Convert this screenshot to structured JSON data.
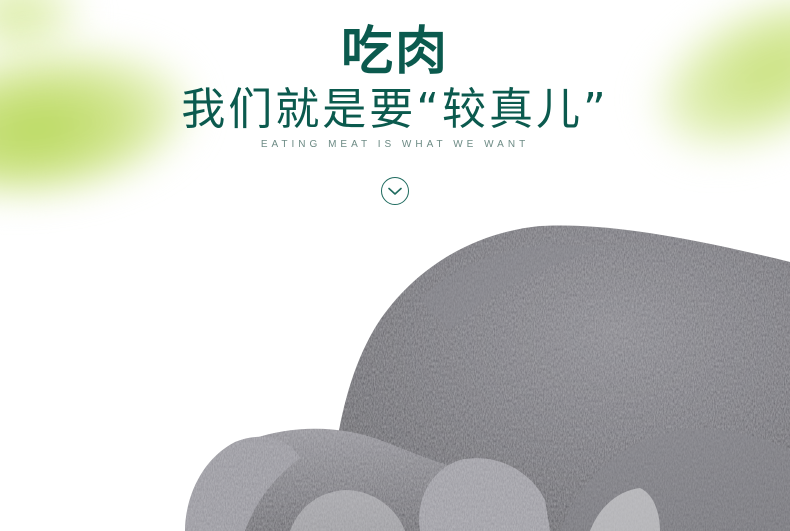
{
  "heading": {
    "line1": "吃肉",
    "line2": "我们就是要“较真儿”",
    "subtitle": "EATING MEAT IS WHAT WE WANT"
  },
  "scroll_icon": "chevron-down-icon",
  "colors": {
    "heading": "#0b5a4e",
    "subtitle": "#6c8a84",
    "leaf_green": "#b7d85a",
    "fur_gray": "#6e6d73",
    "background": "#ffffff"
  },
  "photo": {
    "subject": "schnauzer-dog-photo"
  }
}
